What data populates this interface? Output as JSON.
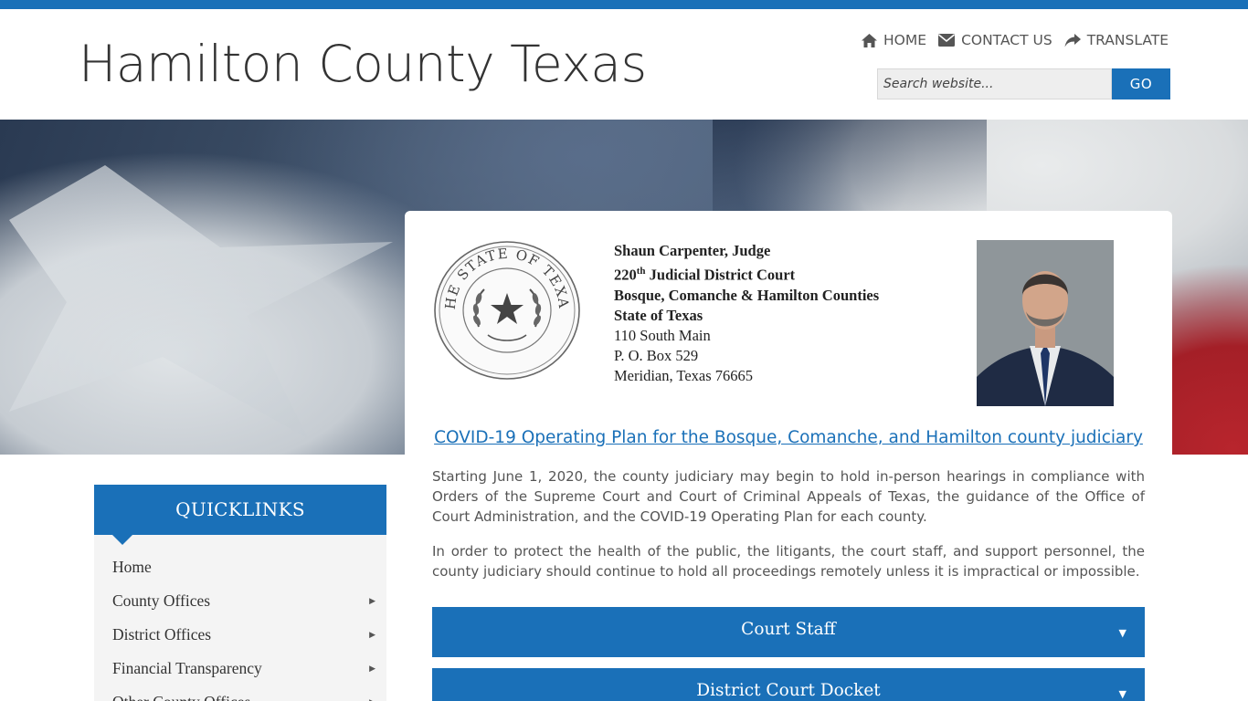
{
  "header": {
    "site_title": "Hamilton County Texas",
    "nav": [
      {
        "icon": "home-icon",
        "label": "HOME"
      },
      {
        "icon": "envelope-icon",
        "label": "CONTACT US"
      },
      {
        "icon": "share-icon",
        "label": "TRANSLATE"
      }
    ],
    "search": {
      "placeholder": "Search website...",
      "button_label": "GO"
    }
  },
  "judge": {
    "name": "Shaun Carpenter, Judge",
    "court_num": "220",
    "court_suffix": "th",
    "court_rest": " Judicial District Court",
    "counties": "Bosque, Comanche & Hamilton Counties",
    "state": "State of Texas",
    "street": "110 South Main",
    "po_box": "P. O. Box 529",
    "city": "Meridian, Texas  76665"
  },
  "seal": {
    "text": "THE STATE OF TEXAS"
  },
  "covid": {
    "link_text": "COVID-19 Operating Plan for the Bosque, Comanche, and Hamilton county judiciary",
    "para1": "Starting June 1, 2020, the county judiciary may begin to hold in-person hearings in compliance with Orders of the Supreme Court and Court of Criminal Appeals of Texas, the guidance of the Office of Court Administration, and the COVID-19 Operating Plan for each county.",
    "para2": "In order to protect the health of the public, the litigants, the court staff, and support personnel, the county judiciary should continue to hold all proceedings remotely unless it is impractical or impossible."
  },
  "accordions": [
    {
      "label": "Court Staff",
      "arrow": "▼"
    },
    {
      "label": "District Court Docket",
      "arrow": "▼"
    }
  ],
  "quicklinks": {
    "title": "QUICKLINKS",
    "items": [
      {
        "label": "Home",
        "caret": ""
      },
      {
        "label": "County Offices",
        "caret": "▶"
      },
      {
        "label": "District Offices",
        "caret": "▶"
      },
      {
        "label": "Financial Transparency",
        "caret": "▶"
      },
      {
        "label": "Other County Offices",
        "caret": "▶"
      }
    ]
  },
  "colors": {
    "primary": "#1a70b8",
    "link": "#1a70b8",
    "sidebar_bg": "#f4f4f4"
  }
}
